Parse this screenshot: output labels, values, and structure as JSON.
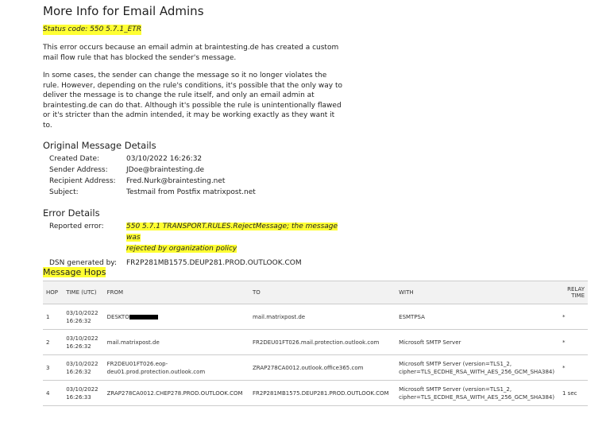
{
  "title": "More Info for Email Admins",
  "status_code": "Status code: 550 5.7.1_ETR",
  "para1": "This error occurs because an email admin at braintesting.de has created a custom mail flow rule that has blocked the sender's message.",
  "para2": "In some cases, the sender can change the message so it no longer violates the rule. However, depending on the rule's conditions, it's possible that the only way to deliver the message is to change the rule itself, and only an email admin at braintesting.de can do that. Although it's possible the rule is unintentionally flawed or it's stricter than the admin intended, it may be working exactly as they want it to.",
  "original": {
    "heading": "Original Message Details",
    "rows": [
      {
        "k": "Created Date:",
        "v": "03/10/2022 16:26:32"
      },
      {
        "k": "Sender Address:",
        "v": "JDoe@braintesting.de"
      },
      {
        "k": "Recipient Address:",
        "v": "Fred.Nurk@braintesting.net"
      },
      {
        "k": "Subject:",
        "v": "Testmail from Postfix matrixpost.net"
      }
    ]
  },
  "error": {
    "heading": "Error Details",
    "reported_label": "Reported error:",
    "reported_line1": "550 5.7.1 TRANSPORT.RULES.RejectMessage; the message was",
    "reported_line2": "rejected by organization policy",
    "dsn_label": "DSN generated by:",
    "dsn": "FR2P281MB1575.DEUP281.PROD.OUTLOOK.COM"
  },
  "hops": {
    "heading": "Message Hops",
    "columns": [
      "HOP",
      "TIME (UTC)",
      "FROM",
      "TO",
      "WITH",
      "RELAY TIME"
    ],
    "rows": [
      {
        "hop": "1",
        "date": "03/10/2022",
        "time": "16:26:32",
        "from1": "DESKTO",
        "from2": "",
        "to": "mail.matrixpost.de",
        "with1": "ESMTPSA",
        "with2": "",
        "relay": "*"
      },
      {
        "hop": "2",
        "date": "03/10/2022",
        "time": "16:26:32",
        "from1": "mail.matrixpost.de",
        "from2": "",
        "to": "FR2DEU01FT026.mail.protection.outlook.com",
        "with1": "Microsoft SMTP Server",
        "with2": "",
        "relay": "*"
      },
      {
        "hop": "3",
        "date": "03/10/2022",
        "time": "16:26:32",
        "from1": "FR2DEU01FT026.eop-",
        "from2": "deu01.prod.protection.outlook.com",
        "to": "ZRAP278CA0012.outlook.office365.com",
        "with1": "Microsoft SMTP Server (version=TLS1_2,",
        "with2": "cipher=TLS_ECDHE_RSA_WITH_AES_256_GCM_SHA384)",
        "relay": "*"
      },
      {
        "hop": "4",
        "date": "03/10/2022",
        "time": "16:26:33",
        "from1": "ZRAP278CA0012.CHEP278.PROD.OUTLOOK.COM",
        "from2": "",
        "to": "FR2P281MB1575.DEUP281.PROD.OUTLOOK.COM",
        "with1": "Microsoft SMTP Server (version=TLS1_2,",
        "with2": "cipher=TLS_ECDHE_RSA_WITH_AES_256_GCM_SHA384)",
        "relay": "1 sec"
      }
    ]
  }
}
